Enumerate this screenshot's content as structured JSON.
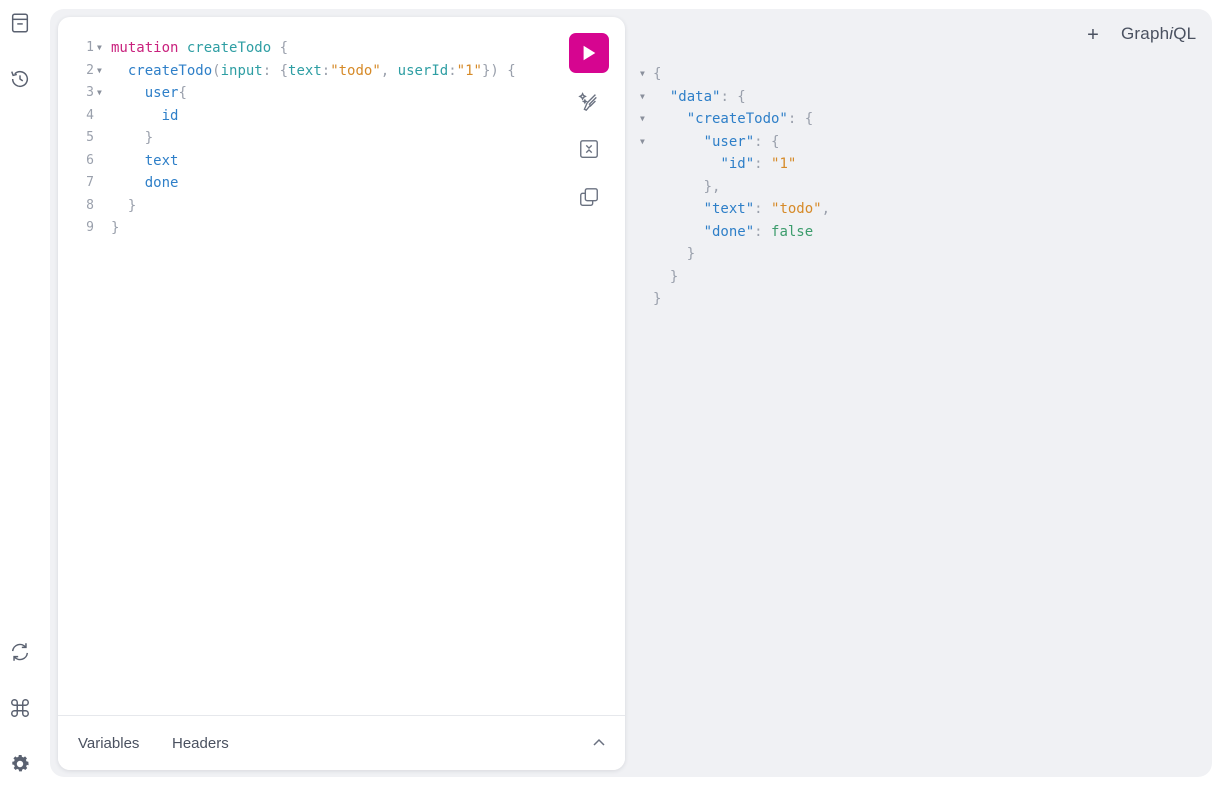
{
  "header": {
    "add_tab_label": "+",
    "logo_prefix": "Graph",
    "logo_italic": "i",
    "logo_suffix": "QL"
  },
  "sidebar": {
    "top_icons": [
      "docs-icon",
      "history-icon"
    ],
    "bottom_icons": [
      "refetch-icon",
      "shortcuts-icon",
      "settings-icon"
    ]
  },
  "editor": {
    "line_numbers": [
      "1",
      "2",
      "3",
      "4",
      "5",
      "6",
      "7",
      "8",
      "9"
    ],
    "lines": [
      {
        "indent": "",
        "tokens": [
          {
            "t": "mutation",
            "c": "kw"
          },
          {
            "t": " ",
            "c": ""
          },
          {
            "t": "createTodo",
            "c": "def"
          },
          {
            "t": " ",
            "c": ""
          },
          {
            "t": "{",
            "c": "punc"
          }
        ],
        "fold": true
      },
      {
        "indent": "  ",
        "tokens": [
          {
            "t": "createTodo",
            "c": "fn"
          },
          {
            "t": "(",
            "c": "punc"
          },
          {
            "t": "input",
            "c": "arg"
          },
          {
            "t": ": ",
            "c": "punc"
          },
          {
            "t": "{",
            "c": "punc"
          },
          {
            "t": "text",
            "c": "arg"
          },
          {
            "t": ":",
            "c": "punc"
          },
          {
            "t": "\"todo\"",
            "c": "str"
          },
          {
            "t": ", ",
            "c": "punc"
          },
          {
            "t": "userId",
            "c": "arg"
          },
          {
            "t": ":",
            "c": "punc"
          },
          {
            "t": "\"1\"",
            "c": "str"
          },
          {
            "t": "}) {",
            "c": "punc"
          }
        ],
        "fold": true
      },
      {
        "indent": "    ",
        "tokens": [
          {
            "t": "user",
            "c": "fn"
          },
          {
            "t": "{",
            "c": "punc"
          }
        ],
        "fold": true
      },
      {
        "indent": "      ",
        "tokens": [
          {
            "t": "id",
            "c": "prop"
          }
        ],
        "fold": false
      },
      {
        "indent": "    ",
        "tokens": [
          {
            "t": "}",
            "c": "punc"
          }
        ],
        "fold": false
      },
      {
        "indent": "    ",
        "tokens": [
          {
            "t": "text",
            "c": "prop"
          }
        ],
        "fold": false
      },
      {
        "indent": "    ",
        "tokens": [
          {
            "t": "done",
            "c": "prop"
          }
        ],
        "fold": false
      },
      {
        "indent": "  ",
        "tokens": [
          {
            "t": "}",
            "c": "punc"
          }
        ],
        "fold": false
      },
      {
        "indent": "",
        "tokens": [
          {
            "t": "}",
            "c": "punc"
          }
        ],
        "fold": false
      }
    ]
  },
  "toolbar": {
    "run_icon": "play-icon",
    "prettify_icon": "prettify-icon",
    "merge_icon": "merge-icon",
    "copy_icon": "copy-icon"
  },
  "bottom_tabs": {
    "variables_label": "Variables",
    "headers_label": "Headers"
  },
  "result": {
    "lines": [
      {
        "indent": "",
        "tokens": [
          {
            "t": "{",
            "c": "punc"
          }
        ],
        "fold": true
      },
      {
        "indent": "  ",
        "tokens": [
          {
            "t": "\"data\"",
            "c": "prop"
          },
          {
            "t": ": ",
            "c": "punc"
          },
          {
            "t": "{",
            "c": "punc"
          }
        ],
        "fold": true
      },
      {
        "indent": "    ",
        "tokens": [
          {
            "t": "\"createTodo\"",
            "c": "prop"
          },
          {
            "t": ": ",
            "c": "punc"
          },
          {
            "t": "{",
            "c": "punc"
          }
        ],
        "fold": true
      },
      {
        "indent": "      ",
        "tokens": [
          {
            "t": "\"user\"",
            "c": "prop"
          },
          {
            "t": ": ",
            "c": "punc"
          },
          {
            "t": "{",
            "c": "punc"
          }
        ],
        "fold": true
      },
      {
        "indent": "        ",
        "tokens": [
          {
            "t": "\"id\"",
            "c": "prop"
          },
          {
            "t": ": ",
            "c": "punc"
          },
          {
            "t": "\"1\"",
            "c": "str"
          }
        ],
        "fold": false
      },
      {
        "indent": "      ",
        "tokens": [
          {
            "t": "},",
            "c": "punc"
          }
        ],
        "fold": false
      },
      {
        "indent": "      ",
        "tokens": [
          {
            "t": "\"text\"",
            "c": "prop"
          },
          {
            "t": ": ",
            "c": "punc"
          },
          {
            "t": "\"todo\"",
            "c": "str"
          },
          {
            "t": ",",
            "c": "punc"
          }
        ],
        "fold": false
      },
      {
        "indent": "      ",
        "tokens": [
          {
            "t": "\"done\"",
            "c": "prop"
          },
          {
            "t": ": ",
            "c": "punc"
          },
          {
            "t": "false",
            "c": "bool"
          }
        ],
        "fold": false
      },
      {
        "indent": "    ",
        "tokens": [
          {
            "t": "}",
            "c": "punc"
          }
        ],
        "fold": false
      },
      {
        "indent": "  ",
        "tokens": [
          {
            "t": "}",
            "c": "punc"
          }
        ],
        "fold": false
      },
      {
        "indent": "",
        "tokens": [
          {
            "t": "}",
            "c": "punc"
          }
        ],
        "fold": false
      }
    ]
  },
  "colors": {
    "accent": "#d60590",
    "panel_bg": "#f0f1f4",
    "keyword": "#c9217d",
    "definition": "#2e9ea3",
    "field": "#2e7fc8",
    "string": "#d68a28",
    "boolean": "#3c9c6c"
  }
}
